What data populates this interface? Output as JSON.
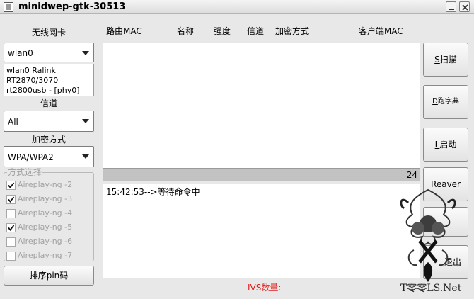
{
  "window": {
    "title": "minidwep-gtk-30513"
  },
  "sidebar": {
    "nic_label": "无线网卡",
    "nic_value": "wlan0",
    "nic_info": [
      "wlan0 Ralink",
      "RT2870/3070",
      "rt2800usb - [phy0]"
    ],
    "channel_label": "信道",
    "channel_value": "All",
    "encryption_label": "加密方式",
    "encryption_value": "WPA/WPA2",
    "method_group_label": "方式选择",
    "methods": [
      {
        "label": "Aireplay-ng -2",
        "checked": true
      },
      {
        "label": "Aireplay-ng -3",
        "checked": true
      },
      {
        "label": "Aireplay-ng -4",
        "checked": false
      },
      {
        "label": "Aireplay-ng -5",
        "checked": true
      },
      {
        "label": "Aireplay-ng -6",
        "checked": false
      },
      {
        "label": "Aireplay-ng -7",
        "checked": false
      }
    ],
    "sort_pin_label": "排序pin码"
  },
  "table": {
    "headers": {
      "router_mac": "路由MAC",
      "name": "名称",
      "strength": "强度",
      "channel": "信道",
      "encryption": "加密方式",
      "client_mac": "客户端MAC"
    }
  },
  "status": {
    "count": "24"
  },
  "log": {
    "line": "15:42:53-->等待命令中"
  },
  "buttons": {
    "scan": {
      "key": "S",
      "text": "扫描"
    },
    "dict": {
      "key": "D",
      "text": "跑字典"
    },
    "launch": {
      "key": "L",
      "text": "启动"
    },
    "reaver": {
      "key": "R",
      "text": "eaver"
    },
    "exit": {
      "text": "退出"
    }
  },
  "footer": {
    "ivs_label": "IVS数量:"
  },
  "watermark": {
    "text": "T零零LS.Net"
  }
}
